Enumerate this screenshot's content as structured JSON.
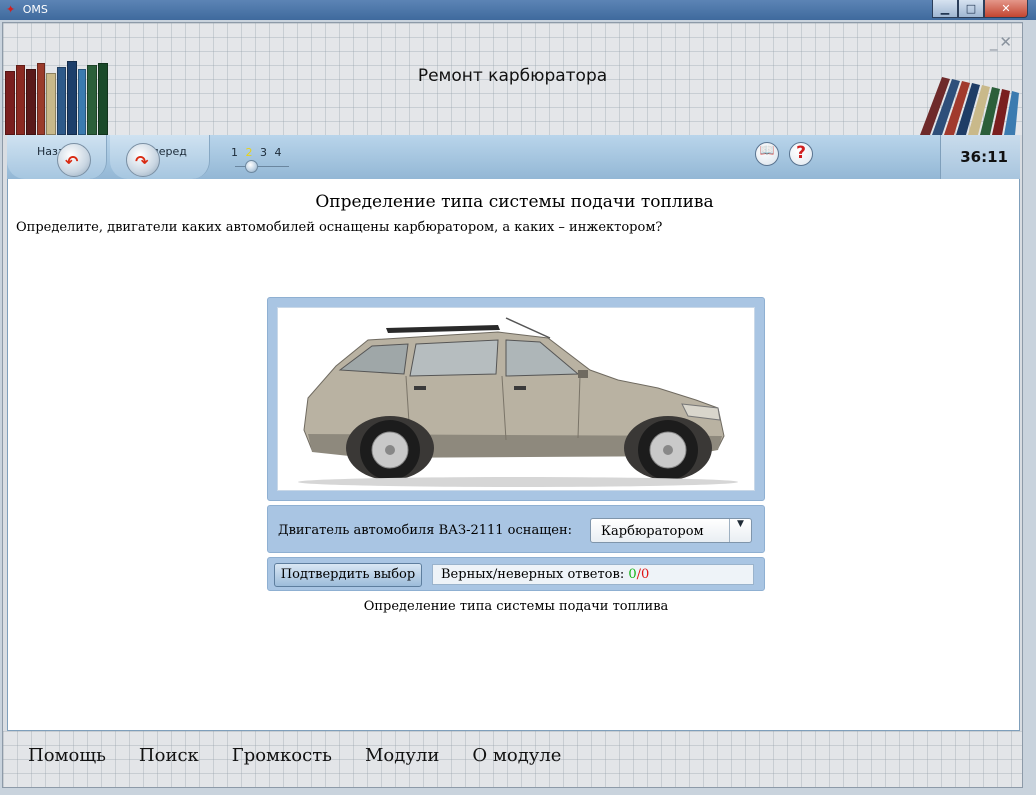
{
  "window": {
    "title": "OMS",
    "logo_glyph": "✦",
    "controls": {
      "minimize": "▁",
      "maximize": "□",
      "close": "✕"
    }
  },
  "app": {
    "title": "Ремонт карбюратора",
    "mini_controls": "_✕"
  },
  "toolbar": {
    "back_label": "Назад",
    "forward_label": "Вперед",
    "pages": [
      "1",
      "2",
      "3",
      "4"
    ],
    "current_page": "2",
    "timer": "36:11",
    "icons": {
      "book": "📖",
      "help": "?"
    }
  },
  "content": {
    "title": "Определение типа системы подачи топлива",
    "question": "Определите, двигатели каких автомобилей оснащены карбюратором, а каких – инжектором?",
    "engine_label": "Двигатель автомобиля ВАЗ-2111 оснащен:",
    "selected_option": "Карбюратором",
    "select_arrow": "▼",
    "confirm_label": "Подтвердить выбор",
    "score_label": "Верных/неверных ответов:",
    "score_correct": "0",
    "score_separator": "/",
    "score_wrong": "0",
    "caption": "Определение типа системы подачи топлива"
  },
  "footer": {
    "items": [
      "Помощь",
      "Поиск",
      "Громкость",
      "Модули",
      "О модуле"
    ]
  },
  "colors": {
    "accent": "#a9c5e3",
    "correct": "#18b41a",
    "wrong": "#e01515",
    "timer": "#111111"
  }
}
